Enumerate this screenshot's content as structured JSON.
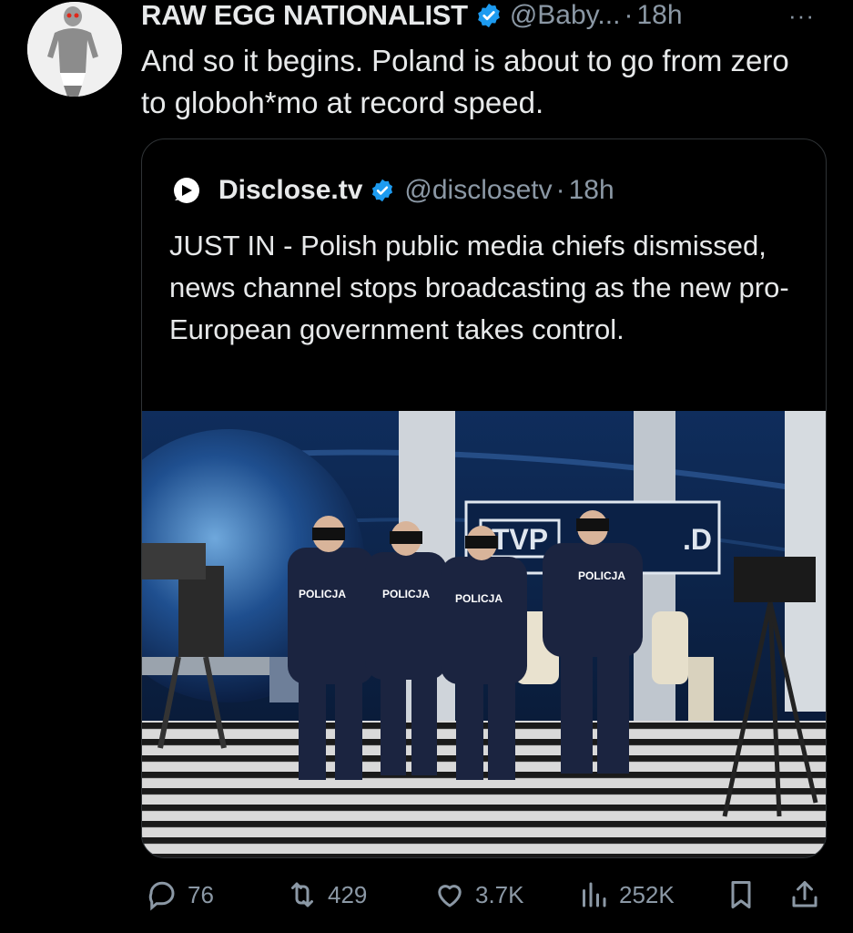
{
  "tweet": {
    "author_name": "RAW EGG NATIONALIST",
    "handle": "@Baby...",
    "separator": "·",
    "time": "18h",
    "more": "···",
    "text": "And so it begins. Poland is about to go from zero to globoh*mo at record speed."
  },
  "quote": {
    "author_name": "Disclose.tv",
    "handle": "@disclosetv",
    "separator": "·",
    "time": "18h",
    "text": "JUST IN - Polish public media chiefs dismissed, news channel stops broadcasting as the new pro-European government takes control.",
    "media": {
      "sign_left": "TVP",
      "sign_right": ".D",
      "vest_labels": [
        "POLICJA",
        "POLICJA",
        "POLICJA",
        "POLICJA"
      ]
    }
  },
  "actions": {
    "replies": "76",
    "reposts": "429",
    "likes": "3.7K",
    "views": "252K"
  },
  "colors": {
    "background": "#000000",
    "text": "#e7e9ea",
    "muted": "#8b98a5",
    "verified": "#1d9bf0",
    "border": "#2f3336"
  },
  "icons": {
    "verified": "verified-badge-icon",
    "more": "more-dots-icon",
    "quote_logo": "disclose-tv-logo-icon",
    "reply": "reply-bubble-icon",
    "repost": "repost-icon",
    "like": "heart-icon",
    "views": "views-bar-chart-icon",
    "bookmark": "bookmark-icon",
    "share": "share-icon"
  }
}
